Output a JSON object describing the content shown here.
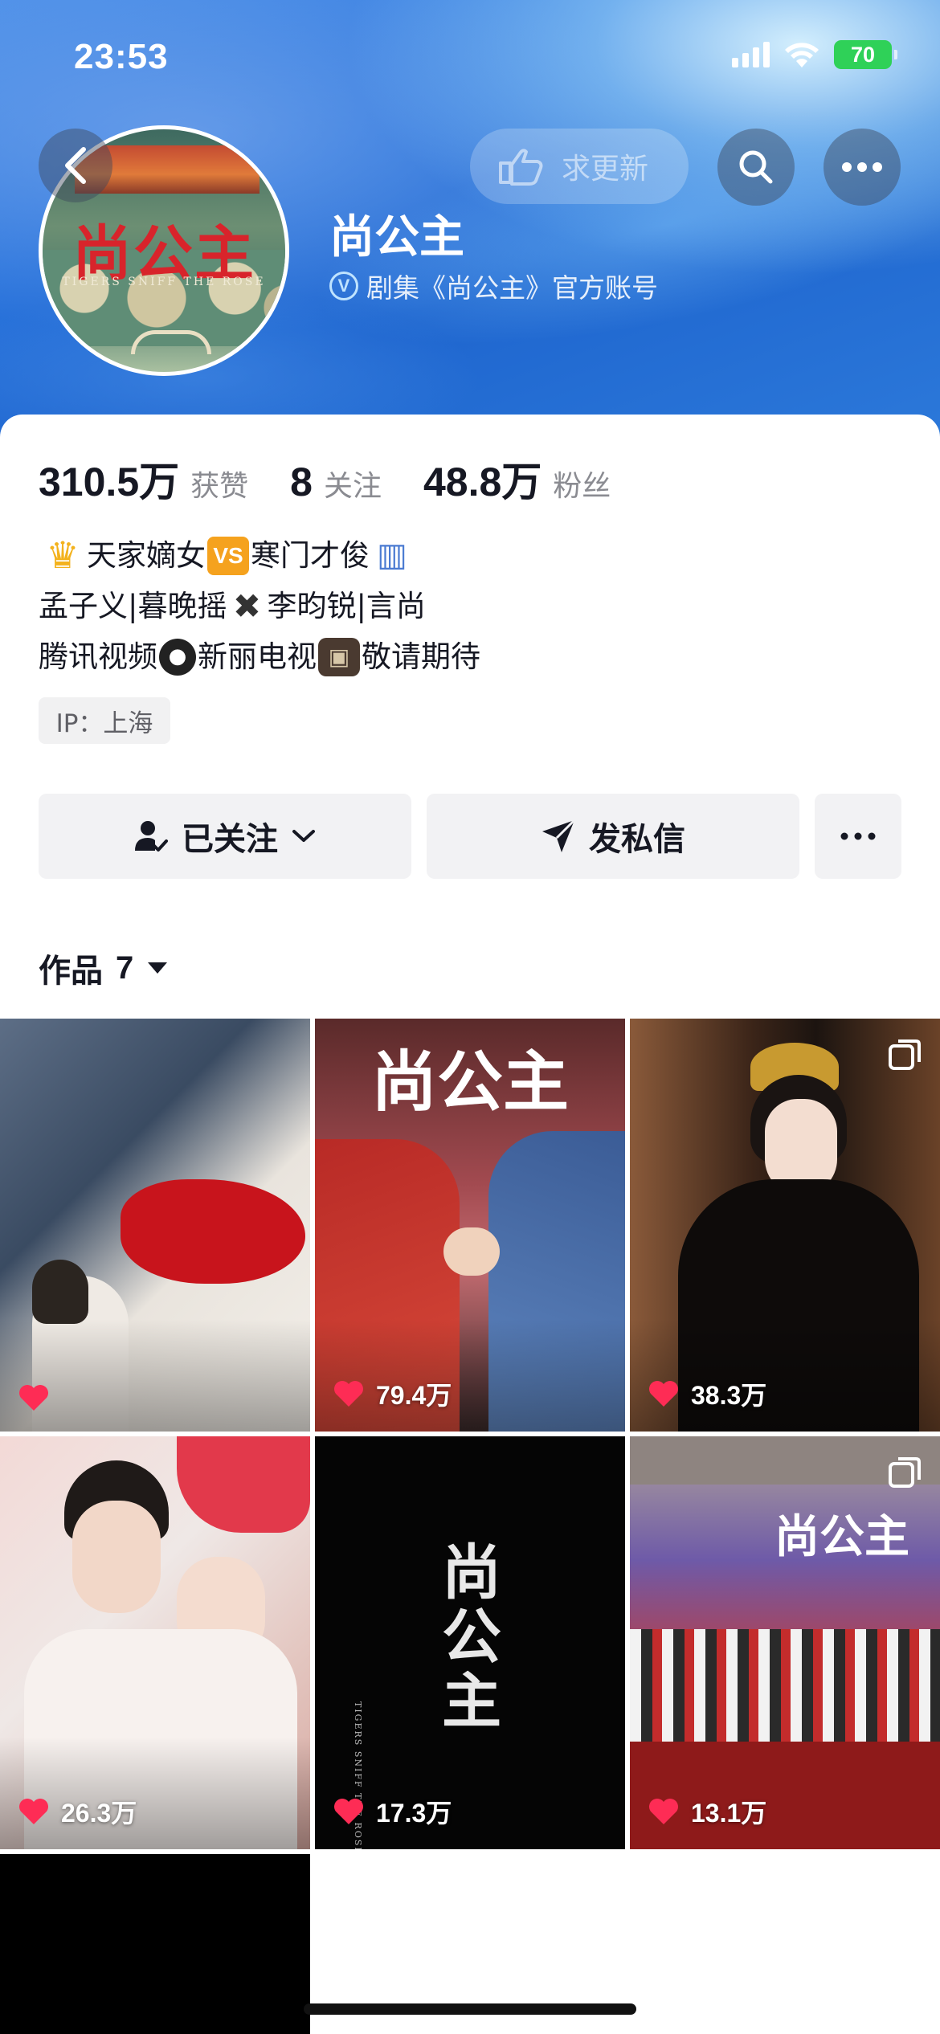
{
  "status_bar": {
    "time": "23:53",
    "battery": "70"
  },
  "header": {
    "request_update_label": "求更新",
    "profile_name": "尚公主",
    "verified_label": "剧集《尚公主》官方账号",
    "avatar_title": "尚公主",
    "avatar_subtitle": "TIGERS SNIFF THE ROSE"
  },
  "stats": [
    {
      "value": "310.5万",
      "label": "获赞"
    },
    {
      "value": "8",
      "label": "关注"
    },
    {
      "value": "48.8万",
      "label": "粉丝"
    }
  ],
  "bio": {
    "line1_a": "天家嫡女",
    "line1_vs": "VS",
    "line1_b": "寒门才俊",
    "line2_a": "孟子义|暮晚摇",
    "line2_b": "李昀锐|言尚",
    "line3_a": "腾讯视频",
    "line3_b": "新丽电视",
    "line3_c": "敬请期待"
  },
  "ip_tag": "IP：上海",
  "actions": {
    "following_label": "已关注",
    "message_label": "发私信"
  },
  "works": {
    "label": "作品",
    "count": "7"
  },
  "videos": [
    {
      "likes": "",
      "multi": false
    },
    {
      "likes": "79.4万",
      "multi": false
    },
    {
      "likes": "38.3万",
      "multi": true
    },
    {
      "likes": "26.3万",
      "multi": false
    },
    {
      "likes": "17.3万",
      "multi": false
    },
    {
      "likes": "13.1万",
      "multi": true
    },
    {
      "likes": "",
      "multi": false
    }
  ],
  "tile_art": {
    "t2_title": "尚公主",
    "t5_title": "尚公主",
    "t5_subtitle": "TIGERS SNIFF THE ROSE",
    "t6_title": "尚公主"
  },
  "colors": {
    "accent_blue": "#2a74dc",
    "like_red": "#fe2c55",
    "battery_green": "#2fd158"
  }
}
